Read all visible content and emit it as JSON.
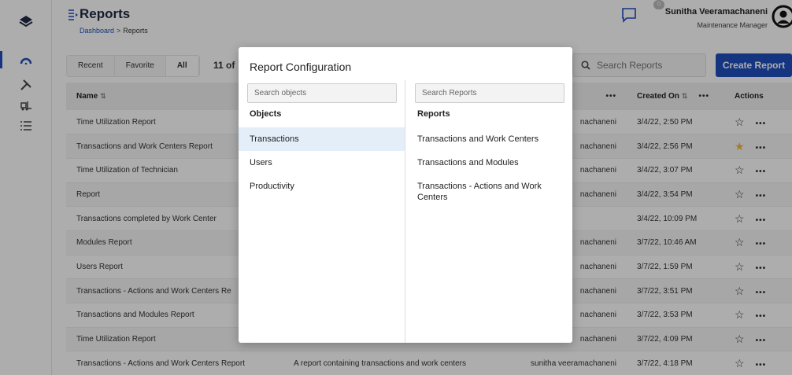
{
  "header": {
    "title": "Reports",
    "breadcrumb": {
      "home": "Dashboard",
      "separator": ">",
      "current": "Reports"
    },
    "notification_count": "0",
    "user": {
      "name": "Sunitha Veeramachaneni",
      "role": "Maintenance Manager"
    }
  },
  "toolbar": {
    "filters": [
      {
        "label": "Recent",
        "active": false
      },
      {
        "label": "Favorite",
        "active": false
      },
      {
        "label": "All",
        "active": true
      }
    ],
    "count_text": "11 of",
    "search_placeholder": "Search Reports",
    "create_label": "Create Report"
  },
  "table": {
    "headers": {
      "name": "Name",
      "created_on": "Created On",
      "actions": "Actions"
    },
    "rows": [
      {
        "name": "Time Utilization Report",
        "desc": "",
        "owner": "nachaneni",
        "created": "3/4/22, 2:50 PM",
        "favorite": false
      },
      {
        "name": "Transactions and Work Centers Report",
        "desc": "",
        "owner": "nachaneni",
        "created": "3/4/22, 2:56 PM",
        "favorite": true
      },
      {
        "name": "Time Utilization of Technician",
        "desc": "",
        "owner": "nachaneni",
        "created": "3/4/22, 3:07 PM",
        "favorite": false
      },
      {
        "name": "Report",
        "desc": "",
        "owner": "nachaneni",
        "created": "3/4/22, 3:54 PM",
        "favorite": false
      },
      {
        "name": "Transactions completed by Work Center",
        "desc": "",
        "owner": "",
        "created": "3/4/22, 10:09 PM",
        "favorite": false
      },
      {
        "name": "Modules Report",
        "desc": "",
        "owner": "nachaneni",
        "created": "3/7/22, 10:46 AM",
        "favorite": false
      },
      {
        "name": "Users Report",
        "desc": "",
        "owner": "nachaneni",
        "created": "3/7/22, 1:59 PM",
        "favorite": false
      },
      {
        "name": "Transactions - Actions and Work Centers Re",
        "desc": "",
        "owner": "nachaneni",
        "created": "3/7/22, 3:51 PM",
        "favorite": false
      },
      {
        "name": "Transactions and Modules Report",
        "desc": "",
        "owner": "nachaneni",
        "created": "3/7/22, 3:53 PM",
        "favorite": false
      },
      {
        "name": "Time Utilization Report",
        "desc": "",
        "owner": "nachaneni",
        "created": "3/7/22, 4:09 PM",
        "favorite": false
      },
      {
        "name": "Transactions - Actions and Work Centers Report",
        "desc": "A report containing transactions and work centers",
        "owner": "sunitha veeramachaneni",
        "created": "3/7/22, 4:18 PM",
        "favorite": false
      }
    ]
  },
  "modal": {
    "title": "Report Configuration",
    "objects": {
      "search_placeholder": "Search objects",
      "heading": "Objects",
      "items": [
        {
          "label": "Transactions",
          "selected": true
        },
        {
          "label": "Users",
          "selected": false
        },
        {
          "label": "Productivity",
          "selected": false
        }
      ]
    },
    "reports": {
      "search_placeholder": "Search Reports",
      "heading": "Reports",
      "items": [
        {
          "label": "Transactions and Work Centers"
        },
        {
          "label": "Transactions and Modules"
        },
        {
          "label": "Transactions - Actions and Work Centers"
        }
      ]
    }
  },
  "colors": {
    "accent": "#1f4fbf",
    "star_active": "#f2b63c",
    "selected_row": "#e3eef9"
  }
}
